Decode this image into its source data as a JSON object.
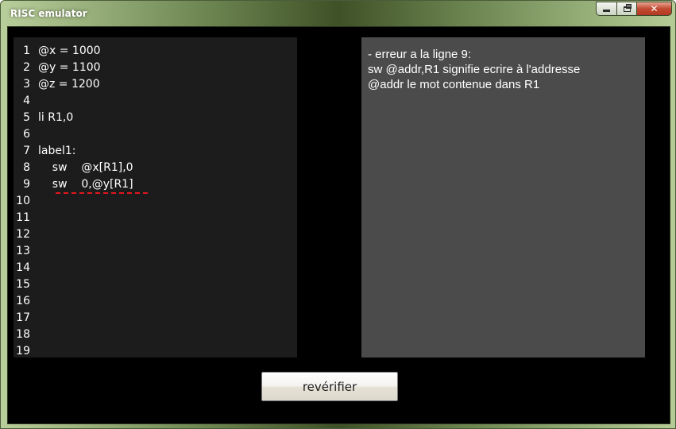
{
  "window": {
    "title": "RISC emulator",
    "accent_color": "#6e8752"
  },
  "editor": {
    "lines": [
      {
        "num": "1",
        "text": "@x = 1000"
      },
      {
        "num": "2",
        "text": "@y = 1100"
      },
      {
        "num": "3",
        "text": "@z = 1200"
      },
      {
        "num": "4",
        "text": ""
      },
      {
        "num": "5",
        "text": "li R1,0"
      },
      {
        "num": "6",
        "text": ""
      },
      {
        "num": "7",
        "text": "label1:"
      },
      {
        "num": "8",
        "text": "    sw    @x[R1],0"
      },
      {
        "num": "9",
        "text": "    sw    0,@y[R1]"
      },
      {
        "num": "10",
        "text": ""
      },
      {
        "num": "11",
        "text": ""
      },
      {
        "num": "12",
        "text": ""
      },
      {
        "num": "13",
        "text": ""
      },
      {
        "num": "14",
        "text": ""
      },
      {
        "num": "15",
        "text": ""
      },
      {
        "num": "16",
        "text": ""
      },
      {
        "num": "17",
        "text": ""
      },
      {
        "num": "18",
        "text": ""
      },
      {
        "num": "19",
        "text": ""
      }
    ],
    "error_line": "9",
    "error_color": "#e0161f"
  },
  "message": {
    "lines": [
      "- erreur a la ligne 9:",
      "sw @addr,R1 signifie ecrire à l'addresse",
      "@addr le mot contenue dans R1"
    ]
  },
  "verify_button": {
    "label": "revérifier"
  }
}
